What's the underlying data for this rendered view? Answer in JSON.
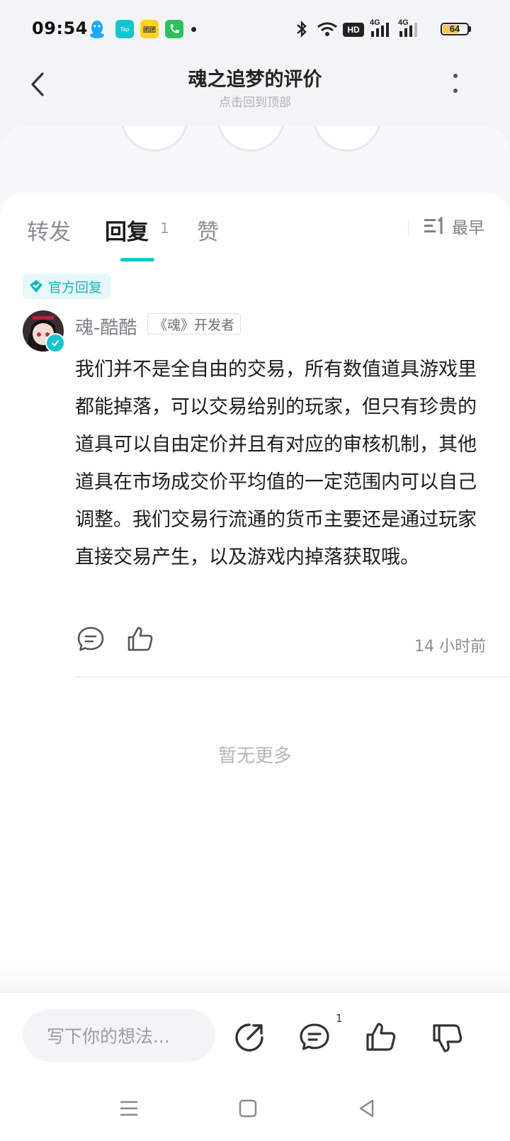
{
  "status_bar": {
    "time": "09:54",
    "tap_label": "Tap",
    "hm_label": "团团",
    "network_1": "4G",
    "network_2": "4G",
    "hd_label": "HD",
    "battery": "64",
    "battery_level": 0.64,
    "icons": [
      "qq-icon",
      "taptap-icon",
      "app-icon",
      "phone-icon",
      "bluetooth-icon",
      "wifi-icon",
      "hd-icon",
      "signal-icon",
      "battery-icon"
    ]
  },
  "header": {
    "title": "魂之追梦的评价",
    "subtitle": "点击回到顶部"
  },
  "tabs": [
    {
      "label": "转发",
      "active": false
    },
    {
      "label": "回复",
      "active": true,
      "count": "1"
    },
    {
      "label": "赞",
      "active": false
    }
  ],
  "sort": {
    "label": "最早"
  },
  "reply": {
    "official_tag": "官方回复",
    "username": "魂-酷酷",
    "role": "《魂》开发者",
    "body": "我们并不是全自由的交易，所有数值道具游戏里都能掉落，可以交易给别的玩家，但只有珍贵的道具可以自由定价并且有对应的审核机制，其他道具在市场成交价平均值的一定范围内可以自己调整。我们交易行流通的货币主要还是通过玩家直接交易产生，以及游戏内掉落获取哦。",
    "time_ago": "14 小时前"
  },
  "list_footer": "暂无更多",
  "bottom_bar": {
    "placeholder": "写下你的想法...",
    "comment_count": "1"
  },
  "colors": {
    "accent": "#15c5ce",
    "official_bg": "#e6f8f8",
    "battery": "#f5c84a"
  }
}
